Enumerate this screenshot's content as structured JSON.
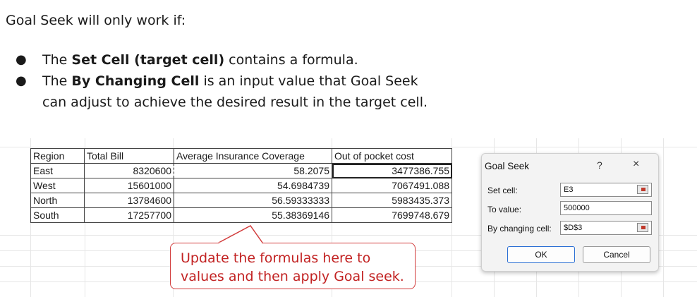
{
  "intro": "Goal Seek will only work if:",
  "bullets": [
    {
      "pre": "The ",
      "bold": "Set Cell (target cell)",
      "post": " contains a formula."
    },
    {
      "pre": "The ",
      "bold": "By Changing Cell",
      "post": " is an input value that Goal Seek can adjust to achieve the desired result in the target cell."
    }
  ],
  "table": {
    "headers": [
      "Region",
      "Total Bill",
      "Average Insurance Coverage",
      "Out of pocket cost"
    ],
    "rows": [
      [
        "East",
        "8320600",
        "58.2075",
        "3477386.755"
      ],
      [
        "West",
        "15601000",
        "54.6984739",
        "7067491.088"
      ],
      [
        "North",
        "13784600",
        "56.59333333",
        "5983435.373"
      ],
      [
        "South",
        "17257700",
        "55.38369146",
        "7699748.679"
      ]
    ]
  },
  "callout": {
    "line1": "Update the formulas here to",
    "line2": "values and then apply Goal seek."
  },
  "dialog": {
    "title": "Goal Seek",
    "help": "?",
    "close": "×",
    "set_cell_label": "Set cell:",
    "set_cell_value": "E3",
    "to_value_label": "To value:",
    "to_value_value": "500000",
    "changing_label": "By changing cell:",
    "changing_value": "$D$3",
    "ok_label": "OK",
    "cancel_label": "Cancel"
  },
  "colors": {
    "callout_red": "#c22222",
    "ok_border": "#2b6fd4"
  }
}
